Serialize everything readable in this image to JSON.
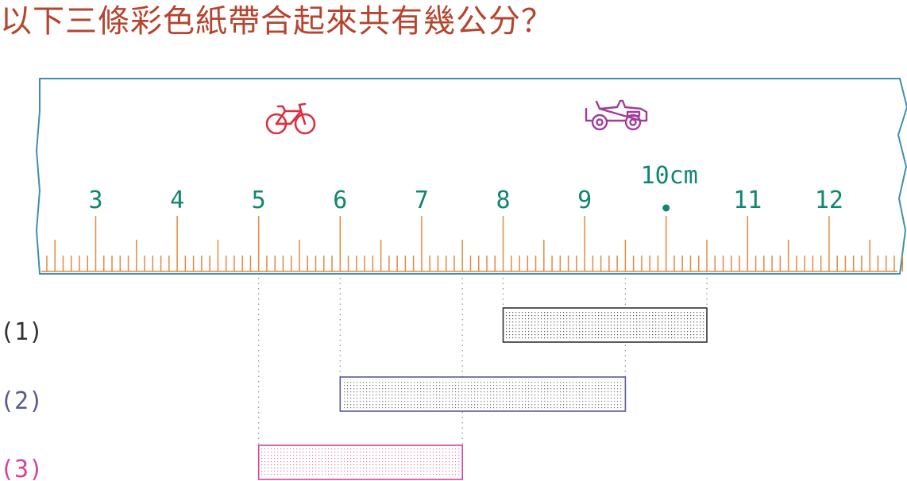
{
  "question": "以下三條彩色紙帶合起來共有幾公分？",
  "ruler": {
    "numbers": [
      {
        "value": 3,
        "label": "3"
      },
      {
        "value": 4,
        "label": "4"
      },
      {
        "value": 5,
        "label": "5"
      },
      {
        "value": 6,
        "label": "6"
      },
      {
        "value": 7,
        "label": "7"
      },
      {
        "value": 8,
        "label": "8"
      },
      {
        "value": 9,
        "label": "9"
      },
      {
        "value": 10,
        "label": "10cm"
      },
      {
        "value": 11,
        "label": "11"
      },
      {
        "value": 12,
        "label": "12"
      }
    ],
    "range_cm": [
      2.35,
      13.0
    ],
    "icons": [
      {
        "name": "bicycle-icon",
        "color": "#d9303e"
      },
      {
        "name": "jeep-icon",
        "color": "#a23c9a"
      }
    ],
    "tick_color": "#e58a3c",
    "border_color": "#3f8fb3",
    "number_color": "#11866f"
  },
  "strips": [
    {
      "label": "(1)",
      "start_cm": 8.0,
      "end_cm": 10.5,
      "color": "#333333"
    },
    {
      "label": "(2)",
      "start_cm": 6.0,
      "end_cm": 9.5,
      "color": "#5a5a9a"
    },
    {
      "label": "(3)",
      "start_cm": 5.0,
      "end_cm": 7.5,
      "color": "#d6449a"
    }
  ]
}
